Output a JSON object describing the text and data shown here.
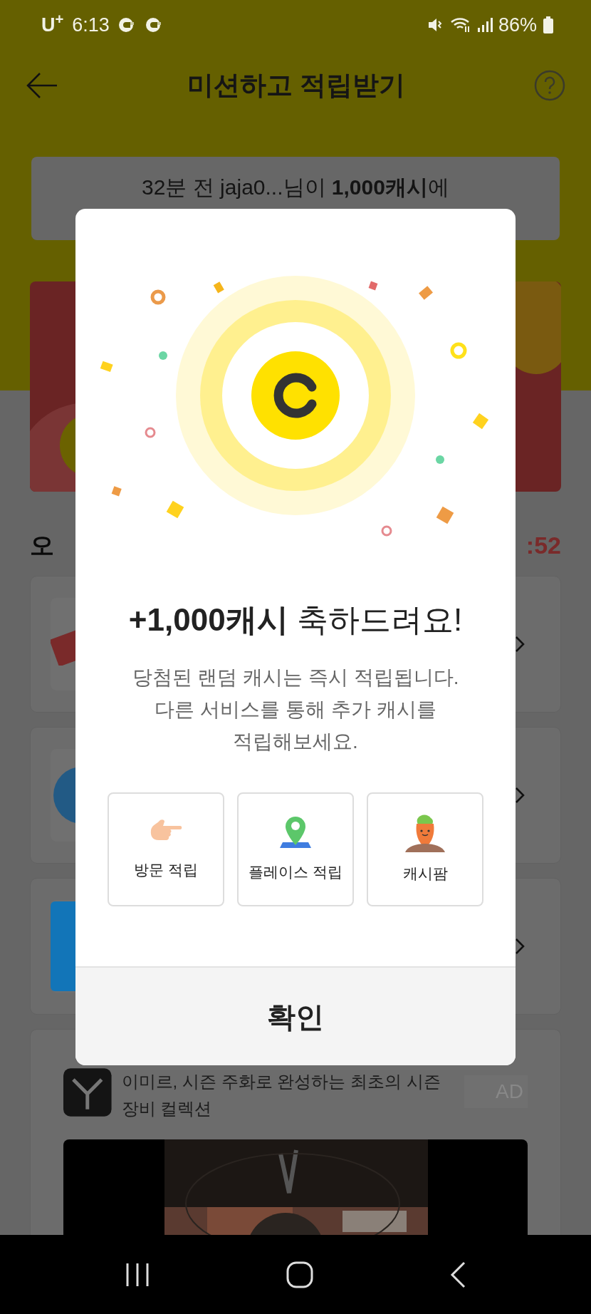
{
  "status_bar": {
    "carrier": "U$^{+}$",
    "time": "6:13",
    "battery": "86%"
  },
  "header": {
    "title": "미션하고 적립받기"
  },
  "notice": {
    "text": "32분 전 jaja0...님이 **1,000캐시**에"
  },
  "section": {
    "title": "오",
    "timer": ":52"
  },
  "ad": {
    "text": "이미르, 시즌 주화로 완성하는 최초의 시즌\n장비 컬렉션",
    "badge": "AD"
  },
  "dialog": {
    "title": "**+1,000캐시** 축하드려요!",
    "description": "당첨된 랜덤 캐시는 즉시 적립됩니다.\n다른 서비스를 통해 추가 캐시를\n적립해보세요.",
    "services": [
      {
        "kind": "hand",
        "label": "방문 적립"
      },
      {
        "kind": "pin",
        "label": "플레이스 적립"
      },
      {
        "kind": "carrot",
        "label": "캐시팜"
      }
    ],
    "confirm": "확인"
  }
}
